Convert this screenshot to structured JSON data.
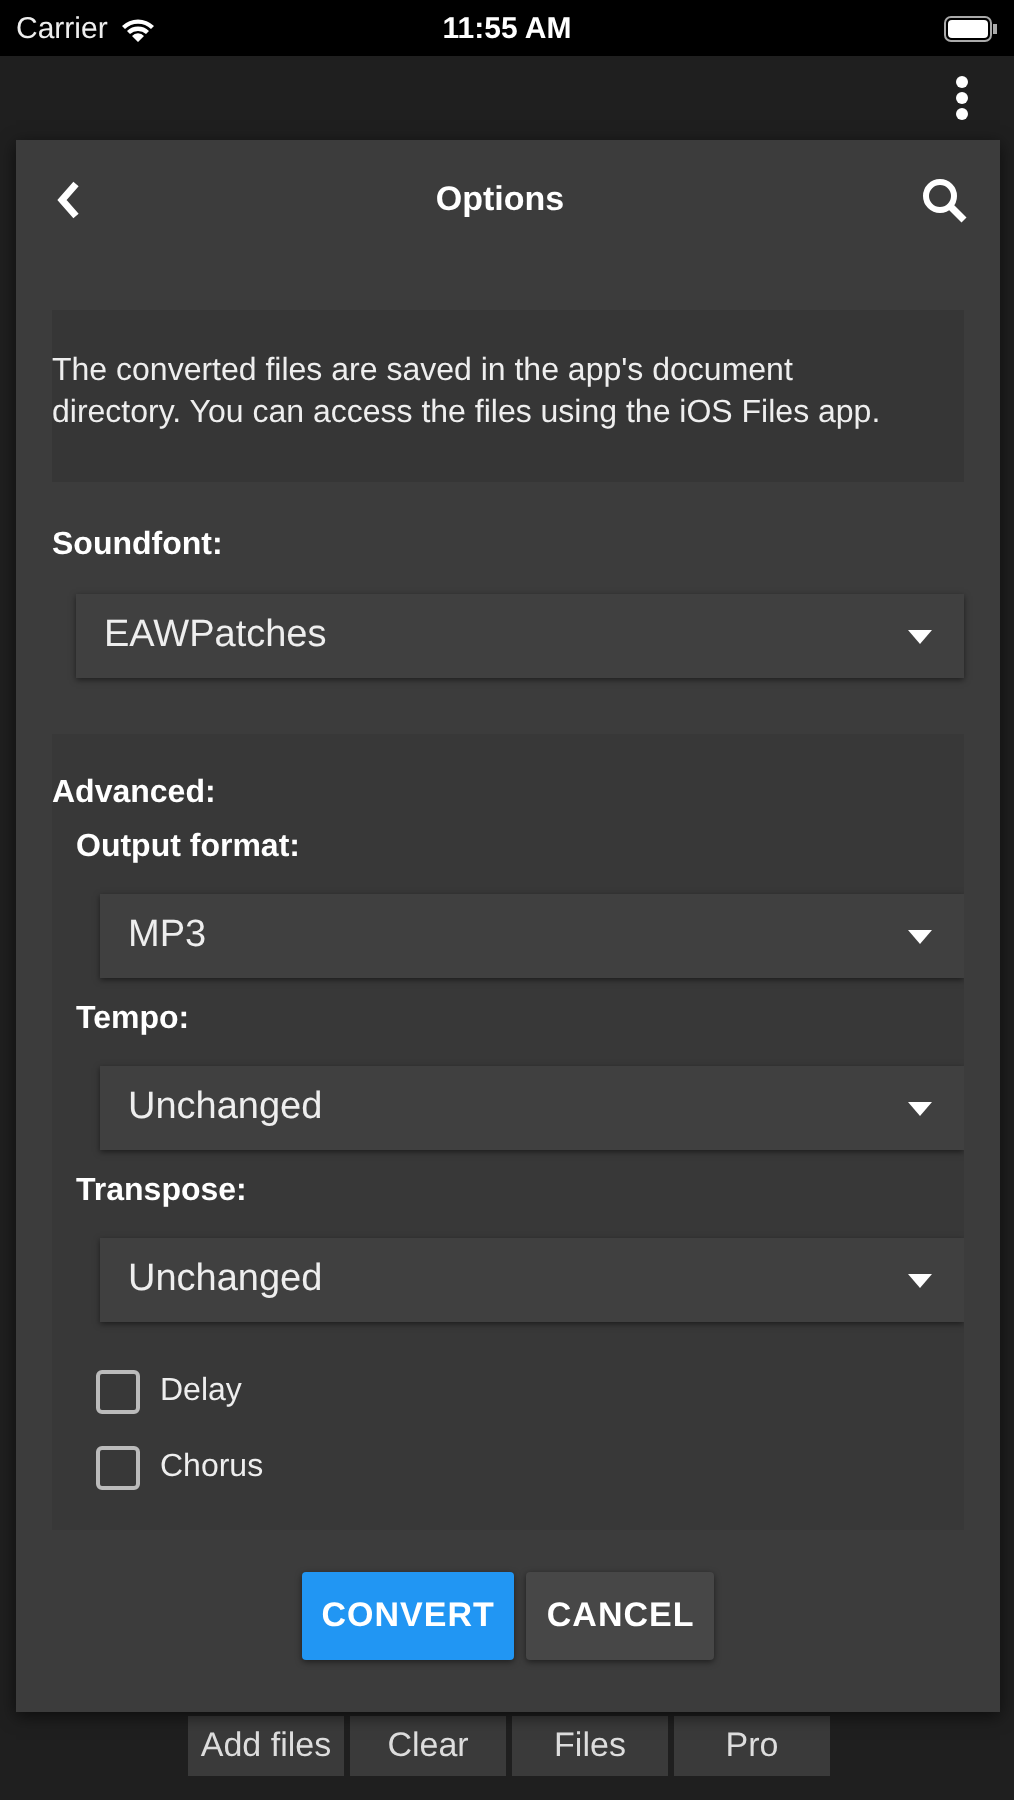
{
  "status_bar": {
    "carrier": "Carrier",
    "time": "11:55 AM"
  },
  "dialog": {
    "title": "Options",
    "info": "The converted files are saved in the app's document directory. You can access the files using the iOS Files app.",
    "soundfont": {
      "label": "Soundfont:",
      "value": "EAWPatches"
    },
    "advanced": {
      "label": "Advanced:",
      "selects": [
        {
          "label": "Output format:",
          "value": "MP3"
        },
        {
          "label": "Tempo:",
          "value": "Unchanged"
        },
        {
          "label": "Transpose:",
          "value": "Unchanged"
        }
      ],
      "checkboxes": [
        {
          "label": "Delay",
          "checked": false
        },
        {
          "label": "Chorus",
          "checked": false
        }
      ]
    },
    "buttons": [
      {
        "label": "CONVERT",
        "kind": "primary"
      },
      {
        "label": "CANCEL",
        "kind": "secondary"
      }
    ]
  },
  "toolbar": [
    "Add files",
    "Clear",
    "Files",
    "Pro"
  ]
}
